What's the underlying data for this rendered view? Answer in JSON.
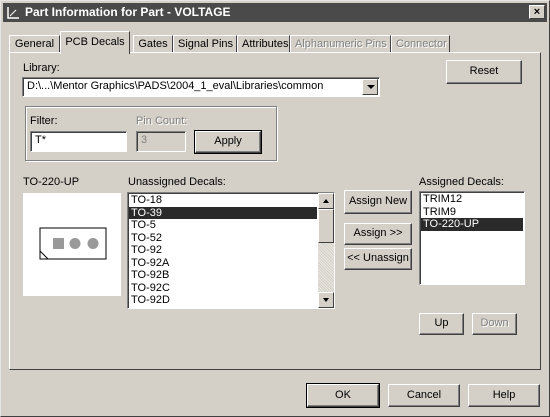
{
  "window": {
    "title": "Part Information for Part - VOLTAGE",
    "close_glyph": "×"
  },
  "tabs": [
    {
      "label": "General",
      "state": "normal"
    },
    {
      "label": "PCB Decals",
      "state": "active"
    },
    {
      "label": "Gates",
      "state": "normal"
    },
    {
      "label": "Signal Pins",
      "state": "normal"
    },
    {
      "label": "Attributes",
      "state": "normal"
    },
    {
      "label": "Alphanumeric Pins",
      "state": "disabled"
    },
    {
      "label": "Connector",
      "state": "disabled"
    }
  ],
  "library": {
    "label": "Library:",
    "value": "D:\\...\\Mentor Graphics\\PADS\\2004_1_eval\\Libraries\\common",
    "reset_label": "Reset"
  },
  "filter": {
    "label": "Filter:",
    "value": "T*",
    "pin_count_label": "Pin Count:",
    "pin_count_value": "3",
    "apply_label": "Apply"
  },
  "preview": {
    "label": "TO-220-UP"
  },
  "unassigned": {
    "label": "Unassigned Decals:",
    "items": [
      "TO-18",
      "TO-39",
      "TO-5",
      "TO-52",
      "TO-92",
      "TO-92A",
      "TO-92B",
      "TO-92C",
      "TO-92D"
    ],
    "selected_index": 1
  },
  "actions": {
    "assign_new": "Assign New",
    "assign": "Assign >>",
    "unassign": "<< Unassign"
  },
  "assigned": {
    "label": "Assigned Decals:",
    "items": [
      "TRIM12",
      "TRIM9",
      "TO-220-UP"
    ],
    "selected_index": 2,
    "up_label": "Up",
    "down_label": "Down"
  },
  "footer": {
    "ok_label": "OK",
    "cancel_label": "Cancel",
    "help_label": "Help"
  },
  "colors": {
    "titlebar": "#4a4a4a",
    "face": "#d4d0c8",
    "selection": "#2a2a2a"
  }
}
